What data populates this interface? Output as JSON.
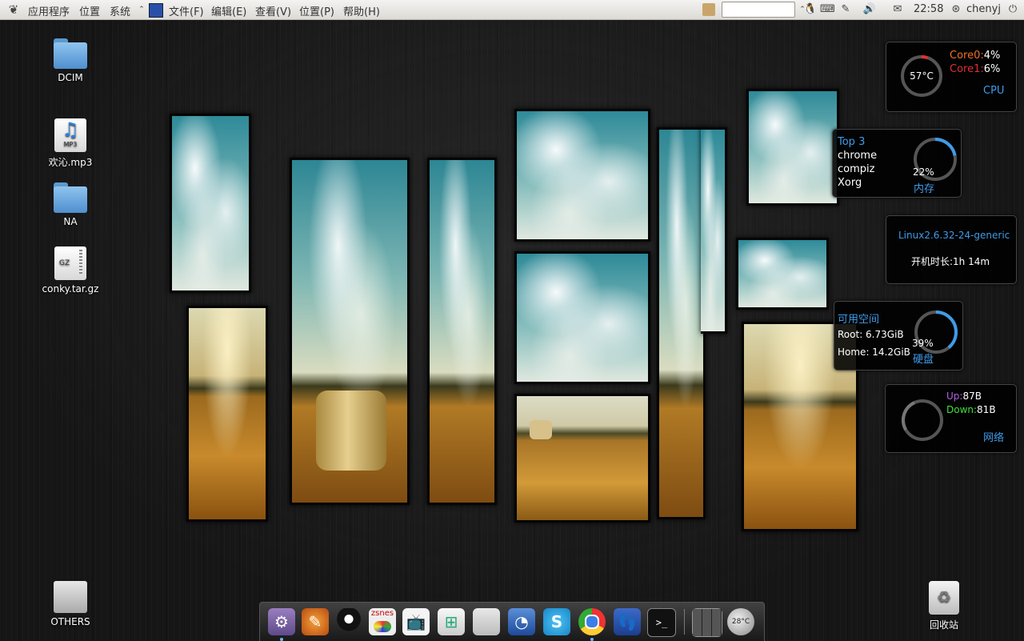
{
  "panel": {
    "menus": [
      "应用程序",
      "位置",
      "系统"
    ],
    "app_menus": [
      "文件(F)",
      "编辑(E)",
      "查看(V)",
      "位置(P)",
      "帮助(H)"
    ],
    "clock": "22:58",
    "user": "chenyj"
  },
  "desktop_icons": {
    "dcim": "DCIM",
    "mp3": "欢沁.mp3",
    "mp3_badge": "MP3",
    "na": "NA",
    "conky": "conky.tar.gz",
    "conky_badge": "GZ",
    "others": "OTHERS",
    "trash": "回收站"
  },
  "conky": {
    "cpu": {
      "temp": "57°C",
      "core0_label": "Core0:",
      "core0_value": "4%",
      "core1_label": "Core1:",
      "core1_value": "6%",
      "title": "CPU",
      "usage_fraction": 0.05
    },
    "memory": {
      "top_label": "Top 3",
      "procs": [
        "chrome",
        "compiz",
        "Xorg"
      ],
      "percent": "22%",
      "title": "内存",
      "fraction": 0.22
    },
    "system": {
      "kernel": "Linux2.6.32-24-generic",
      "uptime": "开机时长:1h 14m"
    },
    "disk": {
      "title_free": "可用空间",
      "root": "Root: 6.73GiB",
      "home": "Home: 14.2GiB",
      "percent": "39%",
      "title": "硬盘",
      "fraction": 0.39
    },
    "network": {
      "up_label": "Up:",
      "up_value": "87B",
      "down_label": "Down:",
      "down_value": "81B",
      "title": "网络"
    }
  },
  "dock": {
    "icons": [
      "settings-icon",
      "paint-icon",
      "qq-icon",
      "zsnes-icon",
      "tv-icon",
      "windows-icon",
      "blank-icon",
      "network-tool-icon",
      "skype-icon",
      "chrome-icon",
      "footprint-icon",
      "terminal-icon",
      "workspace-icon",
      "weather-icon"
    ],
    "zsnes_text": "zsnes",
    "weather_text": "28°C"
  },
  "colors": {
    "accent": "#3f9be8",
    "core0": "#f07020",
    "core1": "#e03030",
    "up": "#b060e0",
    "down": "#40e040"
  }
}
